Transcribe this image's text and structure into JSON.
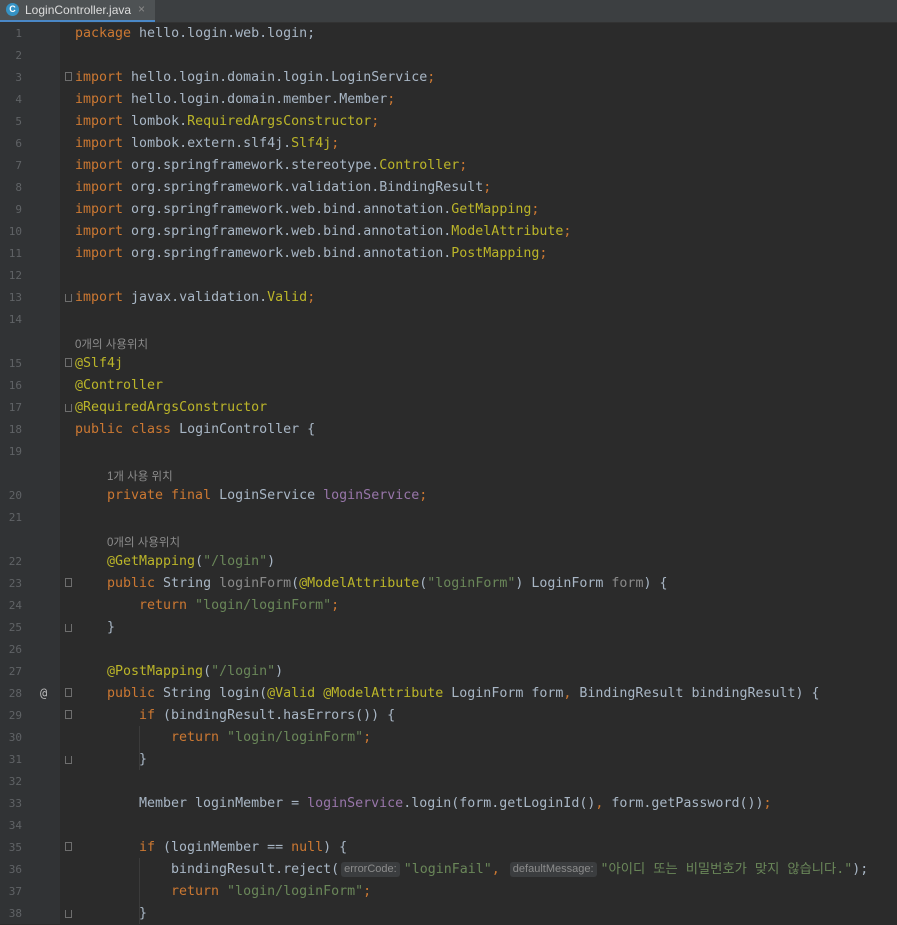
{
  "tab": {
    "file_name": "LoginController.java",
    "file_icon": "C",
    "close_glyph": "×"
  },
  "lines": {
    "l1": {
      "num": "1",
      "t1": "package",
      "t2": " hello.login.web.login;"
    },
    "l2": {
      "num": "2"
    },
    "l3": {
      "num": "3",
      "kw": "import",
      "a": " hello.login.domain.login.LoginService",
      "semi": ";"
    },
    "l4": {
      "num": "4",
      "kw": "import",
      "a": " hello.login.domain.member.Member",
      "semi": ";"
    },
    "l5": {
      "num": "5",
      "kw": "import",
      "a": " lombok.",
      "b": "RequiredArgsConstructor",
      "semi": ";"
    },
    "l6": {
      "num": "6",
      "kw": "import",
      "a": " lombok.extern.slf4j.",
      "b": "Slf4j",
      "semi": ";"
    },
    "l7": {
      "num": "7",
      "kw": "import",
      "a": " org.springframework.stereotype.",
      "b": "Controller",
      "semi": ";"
    },
    "l8": {
      "num": "8",
      "kw": "import",
      "a": " org.springframework.validation.BindingResult",
      "semi": ";"
    },
    "l9": {
      "num": "9",
      "kw": "import",
      "a": " org.springframework.web.bind.annotation.",
      "b": "GetMapping",
      "semi": ";"
    },
    "l10": {
      "num": "10",
      "kw": "import",
      "a": " org.springframework.web.bind.annotation.",
      "b": "ModelAttribute",
      "semi": ";"
    },
    "l11": {
      "num": "11",
      "kw": "import",
      "a": " org.springframework.web.bind.annotation.",
      "b": "PostMapping",
      "semi": ";"
    },
    "l12": {
      "num": "12"
    },
    "l13": {
      "num": "13",
      "kw": "import",
      "a": " javax.validation.",
      "b": "Valid",
      "semi": ";"
    },
    "l14": {
      "num": "14"
    },
    "hint_class": "0개의 사용위치",
    "l15": {
      "num": "15",
      "ann": "@Slf4j"
    },
    "l16": {
      "num": "16",
      "ann": "@Controller"
    },
    "l17": {
      "num": "17",
      "ann": "@RequiredArgsConstructor"
    },
    "l18": {
      "num": "18",
      "kw": "public class",
      "a": " LoginController {"
    },
    "l19": {
      "num": "19"
    },
    "hint_field": "1개 사용 위치",
    "l20": {
      "num": "20",
      "kw": "private final",
      "a": " LoginService ",
      "fld": "loginService",
      "semi": ";"
    },
    "l21": {
      "num": "21"
    },
    "hint_method": "0개의 사용위치",
    "l22": {
      "num": "22",
      "ann": "@GetMapping",
      "p1": "(",
      "str": "\"/login\"",
      "p2": ")"
    },
    "l23": {
      "num": "23",
      "kw": "public",
      "a": " String ",
      "g1": "loginForm",
      "p1": "(",
      "ann": "@ModelAttribute",
      "p2": "(",
      "str": "\"loginForm\"",
      "p3": ") LoginForm ",
      "g2": "form",
      "p4": ") {"
    },
    "l24": {
      "num": "24",
      "kw": "return",
      "str": " \"login/loginForm\"",
      "semi": ";"
    },
    "l25": {
      "num": "25",
      "a": "}"
    },
    "l26": {
      "num": "26"
    },
    "l27": {
      "num": "27",
      "ann": "@PostMapping",
      "p1": "(",
      "str": "\"/login\"",
      "p2": ")"
    },
    "l28": {
      "num": "28",
      "mark": "@",
      "kw": "public",
      "a": " String login(",
      "ann1": "@Valid",
      "sp": " ",
      "ann2": "@ModelAttribute",
      "b": " LoginForm form",
      "c": ",",
      "d": " BindingResult bindingResult) {"
    },
    "l29": {
      "num": "29",
      "kw": "if",
      "a": " (bindingResult.hasErrors()) {"
    },
    "l30": {
      "num": "30",
      "kw": "return",
      "str": " \"login/loginForm\"",
      "semi": ";"
    },
    "l31": {
      "num": "31",
      "a": "}"
    },
    "l32": {
      "num": "32"
    },
    "l33": {
      "num": "33",
      "a": "Member loginMember = ",
      "fld": "loginService",
      "b": ".login(form.getLoginId()",
      "c": ",",
      "d": " form.getPassword())",
      "semi": ";"
    },
    "l34": {
      "num": "34"
    },
    "l35": {
      "num": "35",
      "kw": "if",
      "a": " (loginMember == ",
      "kw2": "null",
      "b": ") {"
    },
    "l36": {
      "num": "36",
      "a": "bindingResult.reject(",
      "inlay1": "errorCode:",
      "str1": "\"loginFail\"",
      "c": ",",
      "inlay2": "defaultMessage:",
      "str2": "\"아이디 또는 비밀번호가 맞지 않습니다.\"",
      "d": ");"
    },
    "l37": {
      "num": "37",
      "kw": "return",
      "str": " \"login/loginForm\"",
      "semi": ";"
    },
    "l38": {
      "num": "38",
      "a": "}"
    }
  }
}
